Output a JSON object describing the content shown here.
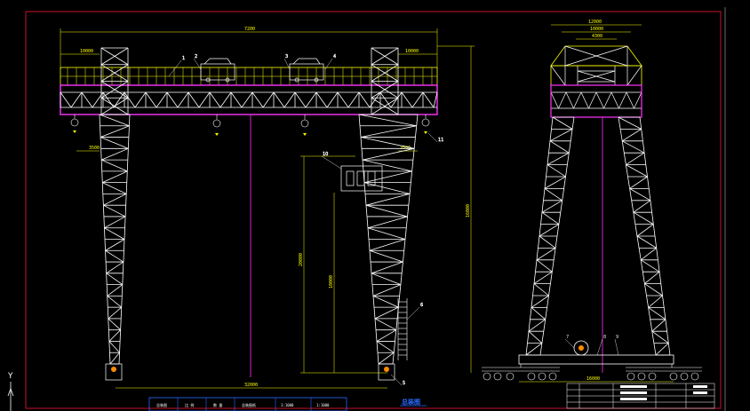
{
  "drawing": {
    "title": "总装图",
    "frame_color": "#c8102e",
    "truss_color": "#ffffff",
    "rail_color": "#ffff00",
    "beam_color": "#ff33ff",
    "dimension_color": "#ffff00",
    "accent_color": "#2a6bff"
  },
  "front_view": {
    "dimensions": {
      "span_top": "7200",
      "cantilever_left": "10000",
      "cantilever_right": "10000",
      "hook_left": "3500",
      "hook_right": "3500",
      "height_main": "16000",
      "height_lift": "20000",
      "height_mid": "10000",
      "span_bottom": "32000"
    },
    "callouts": [
      "1",
      "2",
      "3",
      "4",
      "5",
      "6",
      "10",
      "11"
    ]
  },
  "side_view": {
    "dimensions": {
      "top_outer": "12000",
      "top_mid": "10000",
      "top_inner": "4300",
      "base_width": "16000"
    },
    "callouts": [
      "7",
      "8",
      "9"
    ]
  },
  "title_block": {
    "bottom_strip": [
      "总装图",
      "比 例",
      "数 量",
      "总装图纸",
      "1:1000",
      "1:1000"
    ]
  },
  "ucs": {
    "y_label": "Y"
  }
}
